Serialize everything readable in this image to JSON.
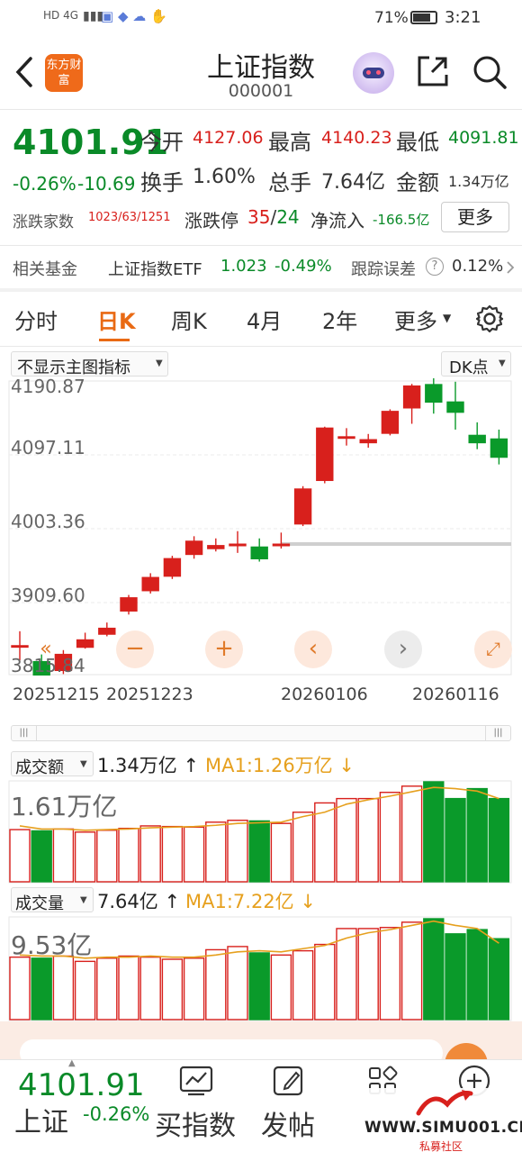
{
  "status_bar": {
    "left": "HD 4G",
    "battery": "71%",
    "time": "3:21"
  },
  "header": {
    "logo": "东方财富",
    "title": "上证指数",
    "code": "000001"
  },
  "quote": {
    "price": "4101.91",
    "change_pct": "-0.26%",
    "change": "-10.69",
    "open_label": "今开",
    "open": "4127.06",
    "high_label": "最高",
    "high": "4140.23",
    "low_label": "最低",
    "low": "4091.81",
    "turnover_label": "换手",
    "turnover": "1.60%",
    "volume_label": "总手",
    "volume": "7.64亿",
    "amount_label": "金额",
    "amount": "1.34万亿",
    "breadth_label": "涨跌家数",
    "breadth": "1023/63/1251",
    "limit_label": "涨跌停",
    "limit_up": "35",
    "limit_slash": "/",
    "limit_down": "24",
    "netflow_label": "净流入",
    "netflow": "-166.5亿",
    "more_label": "更多"
  },
  "fund_row": {
    "label": "相关基金",
    "name": "上证指数ETF",
    "price": "1.023",
    "pct": "-0.49%",
    "track_label": "跟踪误差",
    "track_value": "0.12%"
  },
  "tabs": [
    "分时",
    "日K",
    "周K",
    "4月",
    "2年",
    "更多"
  ],
  "chart_controls": {
    "indicator": "不显示主图指标",
    "dk": "DK点"
  },
  "chart_data": {
    "type": "candlestick",
    "y_ticks": [
      "4190.87",
      "4097.11",
      "4003.36",
      "3909.60",
      "3815.84"
    ],
    "ylim": [
      3815.84,
      4190.87
    ],
    "x_ticks": [
      "20251215",
      "20251223",
      "20260106",
      "20260116"
    ],
    "candles": [
      {
        "o": 3842,
        "c": 3842,
        "h": 3862,
        "l": 3822
      },
      {
        "o": 3820,
        "c": 3800,
        "h": 3830,
        "l": 3795
      },
      {
        "o": 3808,
        "c": 3830,
        "h": 3836,
        "l": 3803
      },
      {
        "o": 3840,
        "c": 3850,
        "h": 3860,
        "l": 3838
      },
      {
        "o": 3858,
        "c": 3866,
        "h": 3874,
        "l": 3855
      },
      {
        "o": 3890,
        "c": 3908,
        "h": 3912,
        "l": 3885
      },
      {
        "o": 3918,
        "c": 3936,
        "h": 3942,
        "l": 3914
      },
      {
        "o": 3938,
        "c": 3962,
        "h": 3966,
        "l": 3934
      },
      {
        "o": 3968,
        "c": 3986,
        "h": 3993,
        "l": 3962
      },
      {
        "o": 3976,
        "c": 3980,
        "h": 3990,
        "l": 3972
      },
      {
        "o": 3980,
        "c": 3982,
        "h": 4000,
        "l": 3970
      },
      {
        "o": 3978,
        "c": 3962,
        "h": 3990,
        "l": 3958
      },
      {
        "o": 3980,
        "c": 3982,
        "h": 3998,
        "l": 3976
      },
      {
        "o": 4010,
        "c": 4058,
        "h": 4062,
        "l": 4007
      },
      {
        "o": 4070,
        "c": 4142,
        "h": 4144,
        "l": 4066
      },
      {
        "o": 4130,
        "c": 4130,
        "h": 4142,
        "l": 4118
      },
      {
        "o": 4122,
        "c": 4126,
        "h": 4134,
        "l": 4115
      },
      {
        "o": 4135,
        "c": 4165,
        "h": 4168,
        "l": 4132
      },
      {
        "o": 4170,
        "c": 4200,
        "h": 4203,
        "l": 4148
      },
      {
        "o": 4202,
        "c": 4178,
        "h": 4232,
        "l": 4162
      },
      {
        "o": 4178,
        "c": 4164,
        "h": 4206,
        "l": 4140
      },
      {
        "o": 4132,
        "c": 4122,
        "h": 4150,
        "l": 4113
      },
      {
        "o": 4127,
        "c": 4102,
        "h": 4140,
        "l": 4092
      }
    ],
    "amount": {
      "label": "成交额",
      "current": "1.34万亿",
      "ma_label": "MA1:1.26万亿",
      "ymax_label": "1.61万亿",
      "values": [
        0.84,
        0.82,
        0.85,
        0.8,
        0.83,
        0.86,
        0.9,
        0.89,
        0.88,
        0.96,
        0.99,
        0.98,
        0.94,
        1.12,
        1.27,
        1.34,
        1.34,
        1.44,
        1.54,
        1.61,
        1.34,
        1.5,
        1.34
      ],
      "ma": [
        0.9,
        0.85,
        0.85,
        0.83,
        0.84,
        0.85,
        0.87,
        0.88,
        0.89,
        0.91,
        0.94,
        0.95,
        0.96,
        1.05,
        1.12,
        1.25,
        1.32,
        1.38,
        1.45,
        1.52,
        1.5,
        1.46,
        1.34
      ]
    },
    "volume": {
      "label": "成交量",
      "current": "7.64亿",
      "ma_label": "MA1:7.22亿",
      "ymax_label": "9.53亿",
      "values": [
        5.9,
        5.8,
        6.0,
        5.5,
        5.8,
        6.0,
        5.9,
        5.7,
        5.8,
        6.6,
        6.9,
        6.3,
        6.1,
        6.5,
        7.1,
        8.6,
        8.6,
        8.7,
        9.2,
        9.53,
        8.1,
        8.5,
        7.64
      ],
      "ma": [
        6.1,
        6.0,
        6.0,
        5.8,
        5.9,
        5.9,
        6.0,
        5.9,
        5.9,
        6.1,
        6.4,
        6.5,
        6.4,
        6.7,
        7.0,
        7.7,
        8.2,
        8.5,
        8.9,
        9.3,
        8.9,
        8.6,
        7.22
      ]
    }
  },
  "bottom_nav": {
    "price": "4101.91",
    "name": "上证",
    "pct": "-0.26%",
    "buy_label": "买指数",
    "post_label": "发帖"
  },
  "watermark": "WWW.SIMU001.CN",
  "watermark_sub": "私募社区"
}
